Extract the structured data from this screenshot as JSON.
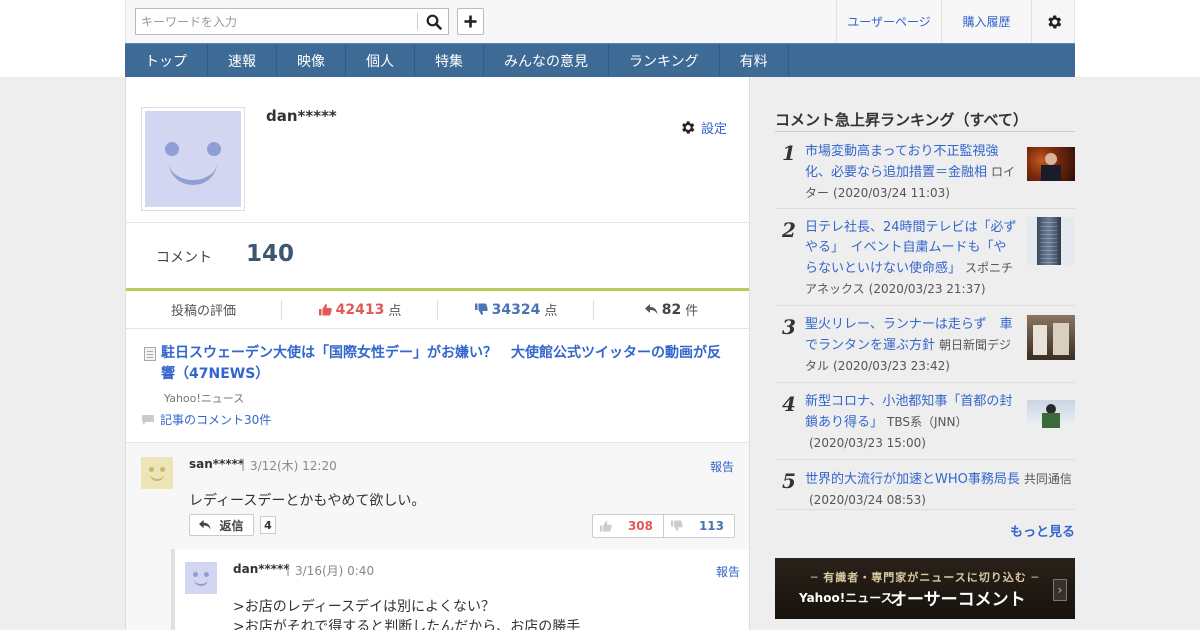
{
  "header": {
    "search_placeholder": "キーワードを入力",
    "user_page": "ユーザーページ",
    "purchase_history": "購入履歴"
  },
  "nav": [
    "トップ",
    "速報",
    "映像",
    "個人",
    "特集",
    "みんなの意見",
    "ランキング",
    "有料"
  ],
  "profile": {
    "username": "dan*****",
    "settings_label": "設定",
    "comment_label": "コメント",
    "comment_count": "140",
    "eval_label": "投稿の評価",
    "likes": "42413",
    "likes_unit": "点",
    "dislikes": "34324",
    "dislikes_unit": "点",
    "replies": "82",
    "replies_unit": "件"
  },
  "article": {
    "title": "駐日スウェーデン大使は「国際女性デー」がお嫌い？　大使館公式ツイッターの動画が反響（47NEWS）",
    "source": "Yahoo!ニュース",
    "comments_link": "記事のコメント30件"
  },
  "comment": {
    "user": "san*****",
    "date": "3/12(木) 12:20",
    "report": "報告",
    "text": "レディースデーとかもやめて欲しい。",
    "reply_label": "返信",
    "reply_count": "4",
    "up": "308",
    "down": "113"
  },
  "reply": {
    "user": "dan*****",
    "date": "3/16(月) 0:40",
    "report": "報告",
    "line1": ">お店のレディースデイは別によくない？",
    "line2": ">お店がそれで得すると判断したんだから、お店の勝手"
  },
  "sidebar": {
    "title": "コメント急上昇ランキング（すべて）",
    "items": [
      {
        "num": "1",
        "title": "市場変動高まっており不正監視強化、必要なら追加措置＝金融相",
        "source": "ロイター",
        "date": "(2020/03/24 11:03)"
      },
      {
        "num": "2",
        "title": "日テレ社長、24時間テレビは「必ずやる」　イベント自粛ムードも「やらないといけない使命感」",
        "source": "スポニチアネックス",
        "date": "(2020/03/23 21:37)"
      },
      {
        "num": "3",
        "title": "聖火リレー、ランナーは走らず　車でランタンを運ぶ方針",
        "source": "朝日新聞デジタル",
        "date": "(2020/03/23 23:42)"
      },
      {
        "num": "4",
        "title": "新型コロナ、小池都知事「首都の封鎖あり得る」",
        "source": "TBS系（JNN）",
        "date": "(2020/03/23 15:00)"
      },
      {
        "num": "5",
        "title": "世界的大流行が加速とWHO事務局長",
        "source": "共同通信",
        "date": "(2020/03/24 08:53)"
      }
    ],
    "more": "もっと見る",
    "banner_line1": "─ 有識者・専門家がニュースに切り込む ─",
    "banner_brand": "Yahoo!ニュース",
    "banner_main": "オーサーコメント"
  },
  "colors": {
    "nav_bg": "#3e6a96",
    "link": "#3366cc",
    "like": "#e15959",
    "dislike": "#4a74b5",
    "accent_rule": "#b5cc5a"
  },
  "icons": [
    "search-icon",
    "plus-icon",
    "gear-icon",
    "thumbs-up-icon",
    "thumbs-down-icon",
    "reply-arrow-icon",
    "document-icon",
    "speech-bubble-icon"
  ]
}
